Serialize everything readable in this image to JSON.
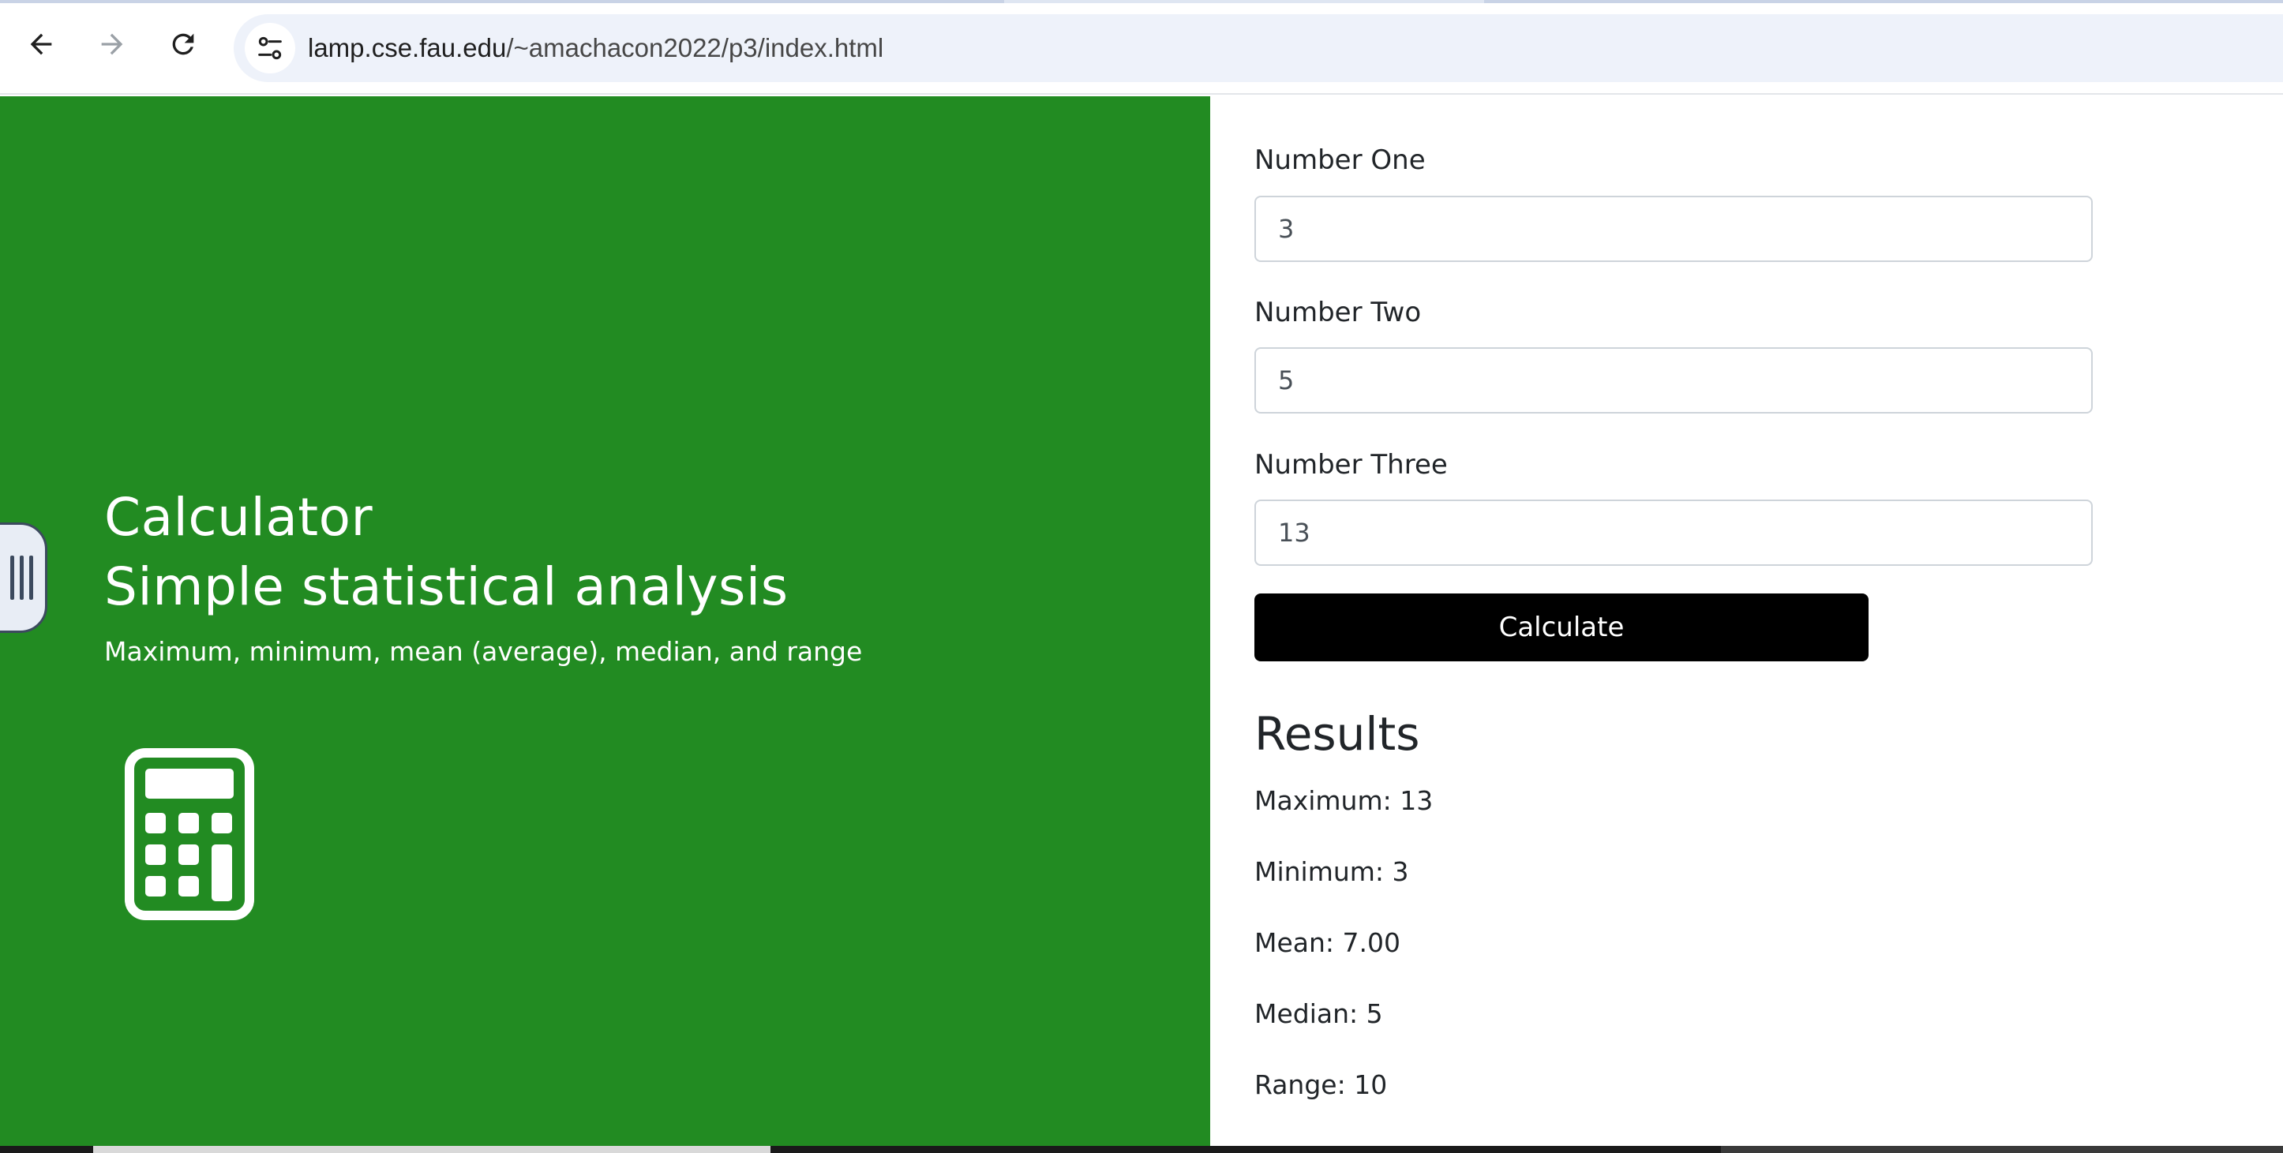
{
  "browser": {
    "url_host": "lamp.cse.fau.edu",
    "url_path": "/~amachacon2022/p3/index.html"
  },
  "hero": {
    "title_line1": "Calculator",
    "title_line2": "Simple statistical analysis",
    "subtitle": "Maximum, minimum, mean (average), median, and range",
    "background_color": "#228b22",
    "icon": "calculator-icon"
  },
  "form": {
    "fields": [
      {
        "label": "Number One",
        "value": "3"
      },
      {
        "label": "Number Two",
        "value": "5"
      },
      {
        "label": "Number Three",
        "value": "13"
      }
    ],
    "button_label": "Calculate"
  },
  "results": {
    "title": "Results",
    "maximum": "Maximum: 13",
    "minimum": "Minimum: 3",
    "mean": "Mean: 7.00",
    "median": "Median: 5",
    "range": "Range: 10"
  }
}
